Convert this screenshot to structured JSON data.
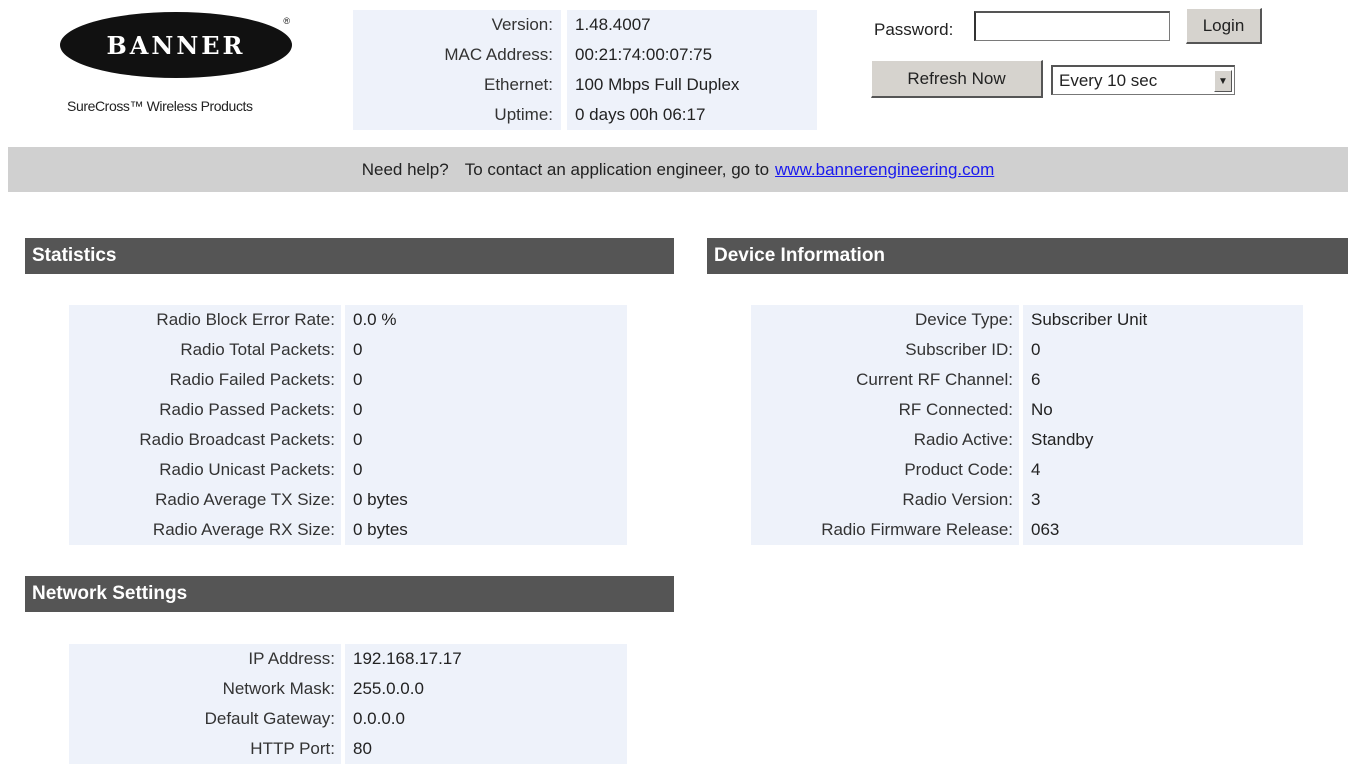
{
  "brand": {
    "logo_text": "BANNER",
    "registered_mark": "®",
    "tagline": "SureCross™ Wireless Products"
  },
  "version_info": [
    {
      "label": "Version:",
      "value": "1.48.4007"
    },
    {
      "label": "MAC Address:",
      "value": "00:21:74:00:07:75"
    },
    {
      "label": "Ethernet:",
      "value": "100 Mbps Full Duplex"
    },
    {
      "label": "Uptime:",
      "value": "0 days 00h 06:17"
    }
  ],
  "login": {
    "password_label": "Password:",
    "password_value": "",
    "login_button": "Login",
    "refresh_button": "Refresh Now",
    "refresh_interval": "Every 10 sec"
  },
  "help_bar": {
    "need_help": "Need help?",
    "text": "To contact an application engineer, go to",
    "link": "www.bannerengineering.com"
  },
  "statistics": {
    "title": "Statistics",
    "rows": [
      {
        "label": "Radio Block Error Rate:",
        "value": "0.0 %"
      },
      {
        "label": "Radio Total Packets:",
        "value": "0"
      },
      {
        "label": "Radio Failed Packets:",
        "value": "0"
      },
      {
        "label": "Radio Passed Packets:",
        "value": "0"
      },
      {
        "label": "Radio Broadcast Packets:",
        "value": "0"
      },
      {
        "label": "Radio Unicast Packets:",
        "value": "0"
      },
      {
        "label": "Radio Average TX Size:",
        "value": "0 bytes"
      },
      {
        "label": "Radio Average RX Size:",
        "value": "0 bytes"
      }
    ]
  },
  "device_information": {
    "title": "Device Information",
    "rows": [
      {
        "label": "Device Type:",
        "value": "Subscriber Unit"
      },
      {
        "label": "Subscriber ID:",
        "value": "0"
      },
      {
        "label": "Current RF Channel:",
        "value": "6"
      },
      {
        "label": "RF Connected:",
        "value": "No"
      },
      {
        "label": "Radio Active:",
        "value": "Standby"
      },
      {
        "label": "Product Code:",
        "value": "4"
      },
      {
        "label": "Radio Version:",
        "value": "3"
      },
      {
        "label": "Radio Firmware Release:",
        "value": "063"
      }
    ]
  },
  "network_settings": {
    "title": "Network Settings",
    "rows": [
      {
        "label": "IP Address:",
        "value": "192.168.17.17"
      },
      {
        "label": "Network Mask:",
        "value": "255.0.0.0"
      },
      {
        "label": "Default Gateway:",
        "value": "0.0.0.0"
      },
      {
        "label": "HTTP Port:",
        "value": "80"
      }
    ]
  },
  "colors": {
    "header_bg": "#555555",
    "row_bg": "#eef2fa",
    "help_bar_bg": "#d0d0d0",
    "link": "#1a1aee"
  }
}
